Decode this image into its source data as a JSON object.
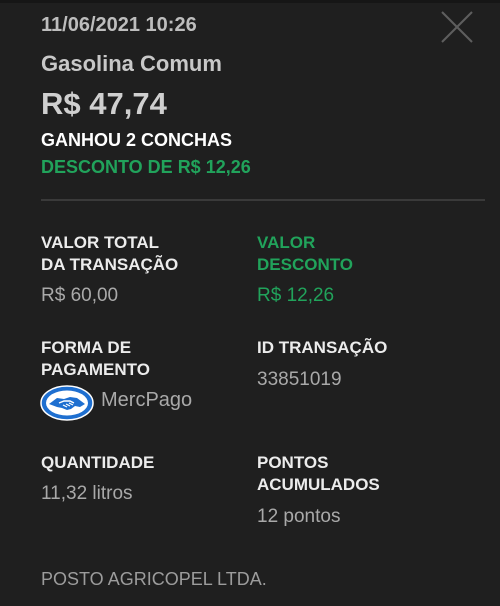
{
  "header": {
    "datetime": "11/06/2021 10:26",
    "product": "Gasolina Comum",
    "price": "R$ 47,74",
    "reward": "GANHOU 2 CONCHAS",
    "discount": "DESCONTO DE R$ 12,26"
  },
  "details": {
    "total_label_1": "VALOR TOTAL",
    "total_label_2": "DA TRANSAÇÃO",
    "total_value": "R$ 60,00",
    "discount_label_1": "VALOR",
    "discount_label_2": "DESCONTO",
    "discount_value": "R$ 12,26",
    "payment_label_1": "FORMA DE",
    "payment_label_2": "PAGAMENTO",
    "payment_method": "MercPago",
    "payment_icon": "handshake-logo-icon",
    "id_label": "ID TRANSAÇÃO",
    "id_value": "33851019",
    "quantity_label": "QUANTIDADE",
    "quantity_value": "11,32 litros",
    "points_label_1": "PONTOS",
    "points_label_2": "ACUMULADOS",
    "points_value": "12 pontos"
  },
  "footer": {
    "station": "POSTO AGRICOPEL LTDA."
  },
  "colors": {
    "background": "#1f1f1f",
    "accent_green": "#21a35b",
    "logo_blue": "#1e6fd0"
  }
}
